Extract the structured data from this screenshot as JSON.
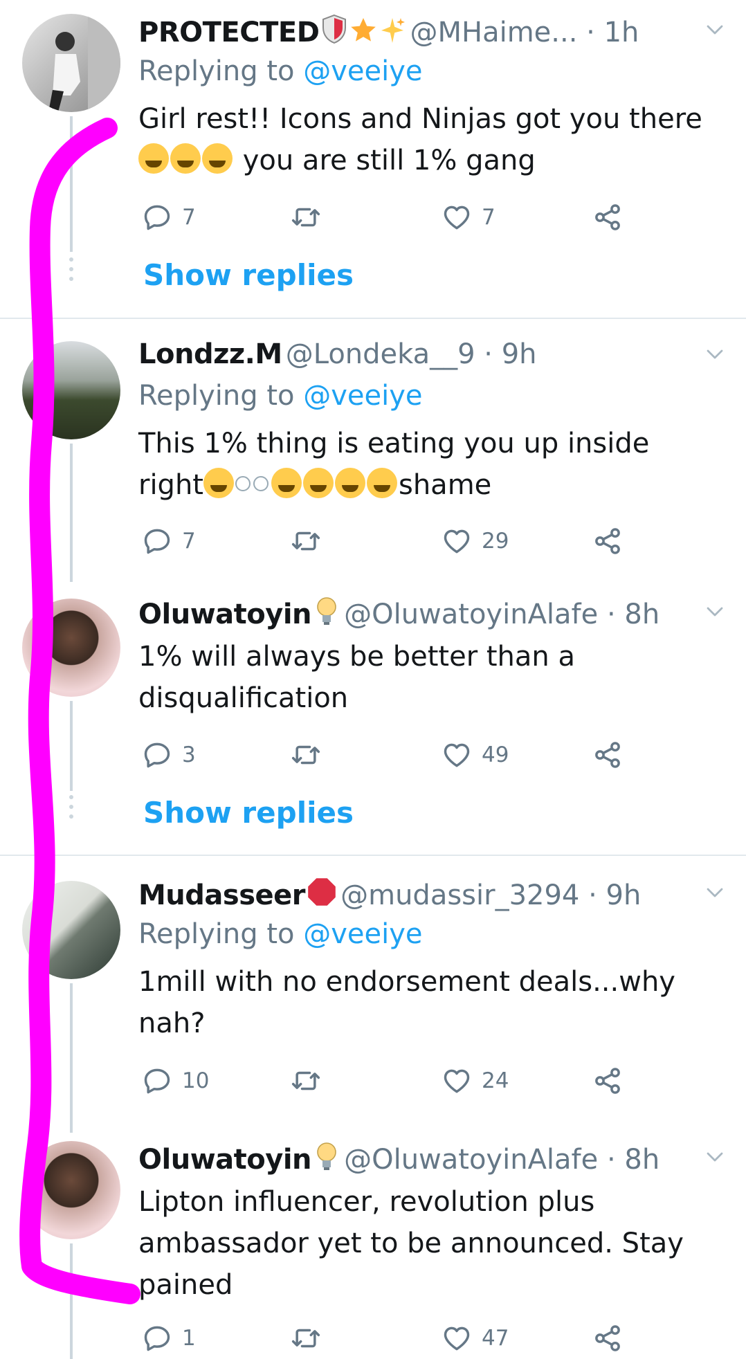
{
  "tweets": [
    {
      "name": "PROTECTED",
      "handle": "@MHaime...",
      "sep": " · ",
      "time": "1h",
      "reply_label": "Replying to ",
      "reply_to": "@veeiye",
      "text_line1": "Girl rest!! Icons and Ninjas got you there",
      "text_line2": " you are still 1% gang",
      "replies": "7",
      "retweets": "",
      "likes": "7",
      "show_replies": "Show replies"
    },
    {
      "name": "Londzz.M",
      "handle": "@Londeka__9",
      "sep": " · ",
      "time": "9h",
      "reply_label": "Replying to ",
      "reply_to": "@veeiye",
      "text_line1": "This 1% thing is eating you up inside",
      "text_line2a": "right",
      "text_line2b": "shame",
      "replies": "7",
      "retweets": "",
      "likes": "29"
    },
    {
      "name": "Oluwatoyin",
      "handle": "@OluwatoyinAlafe",
      "sep": " · ",
      "time": "8h",
      "text_line1": "1% will always be better than a",
      "text_line2": "disqualification",
      "replies": "3",
      "retweets": "",
      "likes": "49",
      "show_replies": "Show replies"
    },
    {
      "name": "Mudasseer",
      "handle": "@mudassir_3294",
      "sep": " · ",
      "time": "9h",
      "reply_label": "Replying to ",
      "reply_to": "@veeiye",
      "text_line1": "1mill with no endorsement deals...why",
      "text_line2": "nah?",
      "replies": "10",
      "retweets": "",
      "likes": "24"
    },
    {
      "name": "Oluwatoyin",
      "handle": "@OluwatoyinAlafe",
      "sep": " · ",
      "time": "8h",
      "text_line1": "Lipton influencer, revolution plus",
      "text_line2": "ambassador yet to be announced. Stay",
      "text_line3": "pained",
      "replies": "1",
      "retweets": "",
      "likes": "47"
    }
  ],
  "colors": {
    "link": "#1da1f2",
    "secondary_text": "#657786",
    "primary_text": "#14171a",
    "marker": "#ff00ff"
  },
  "icons": [
    "reply-icon",
    "retweet-icon",
    "like-icon",
    "share-icon",
    "chevron-down-icon"
  ]
}
